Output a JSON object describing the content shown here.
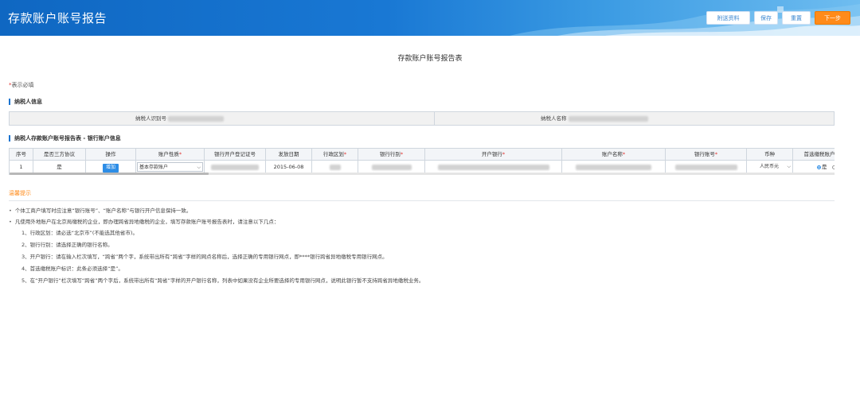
{
  "header": {
    "title": "存款账户账号报告",
    "buttons": {
      "attach": "附送资料",
      "save": "保存",
      "reset": "重置",
      "next": "下一步"
    }
  },
  "page_title": "存款账户账号报告表",
  "required_note": {
    "star": "*",
    "text": "表示必填"
  },
  "taxpayer_section": {
    "title": "纳税人信息",
    "id_label": "纳税人识别号",
    "name_label": "纳税人名称"
  },
  "bank_section": {
    "title": "纳税人存款账户账号报告表 - 银行账户信息",
    "columns": [
      "序号",
      "是否三方协议",
      "操作",
      "账户性质",
      "银行开户登记证号",
      "发放日期",
      "行政区划",
      "银行行别",
      "开户银行",
      "账户名称",
      "银行账号",
      "币种",
      "首选缴税账户标识"
    ],
    "required_columns": [
      "账户性质",
      "行政区划",
      "银行行别",
      "开户银行",
      "账户名称",
      "银行账号"
    ],
    "row": {
      "index": "1",
      "agreement": "是",
      "action": "增加",
      "account_type": "基本存款账户",
      "issue_date": "2015-06-08",
      "currency": "人民币元",
      "preferred_yes": "是",
      "preferred_no": "否"
    }
  },
  "tips": {
    "title": "温馨提示",
    "bullets": [
      "个体工商户填写时应注意“银行账号”、“账户名称”与银行开户信息保持一致。",
      "凡使用外地账户在北京局缴税的企业，即办理跨省异地缴税的企业，填写存款账户账号报告表时，请注意以下几点："
    ],
    "items": [
      "1、行政区划：请必选“北京市”(不能选其他省市)。",
      "2、银行行别：请选择正确的银行名称。",
      "3、开户银行：请在输入栏次填写，“跨省”两个字，系统带出所有“跨省”字样的网点名称后，选择正确的专用银行网点，即****银行跨省异地缴税专用银行网点。",
      "4、首选缴税账户标识：此条必须选择“是”。",
      "5、在“开户银行”栏次填写“跨省”两个字后，系统带出所有“跨省”字样的开户银行名称，列表中如果没有企业所要选择的专用银行网点，说明此银行暂不支持跨省异地缴税业务。"
    ]
  },
  "colors": {
    "header_blue": "#1978d4",
    "accent_orange": "#ff8b1a",
    "required_red": "#e0322e"
  }
}
